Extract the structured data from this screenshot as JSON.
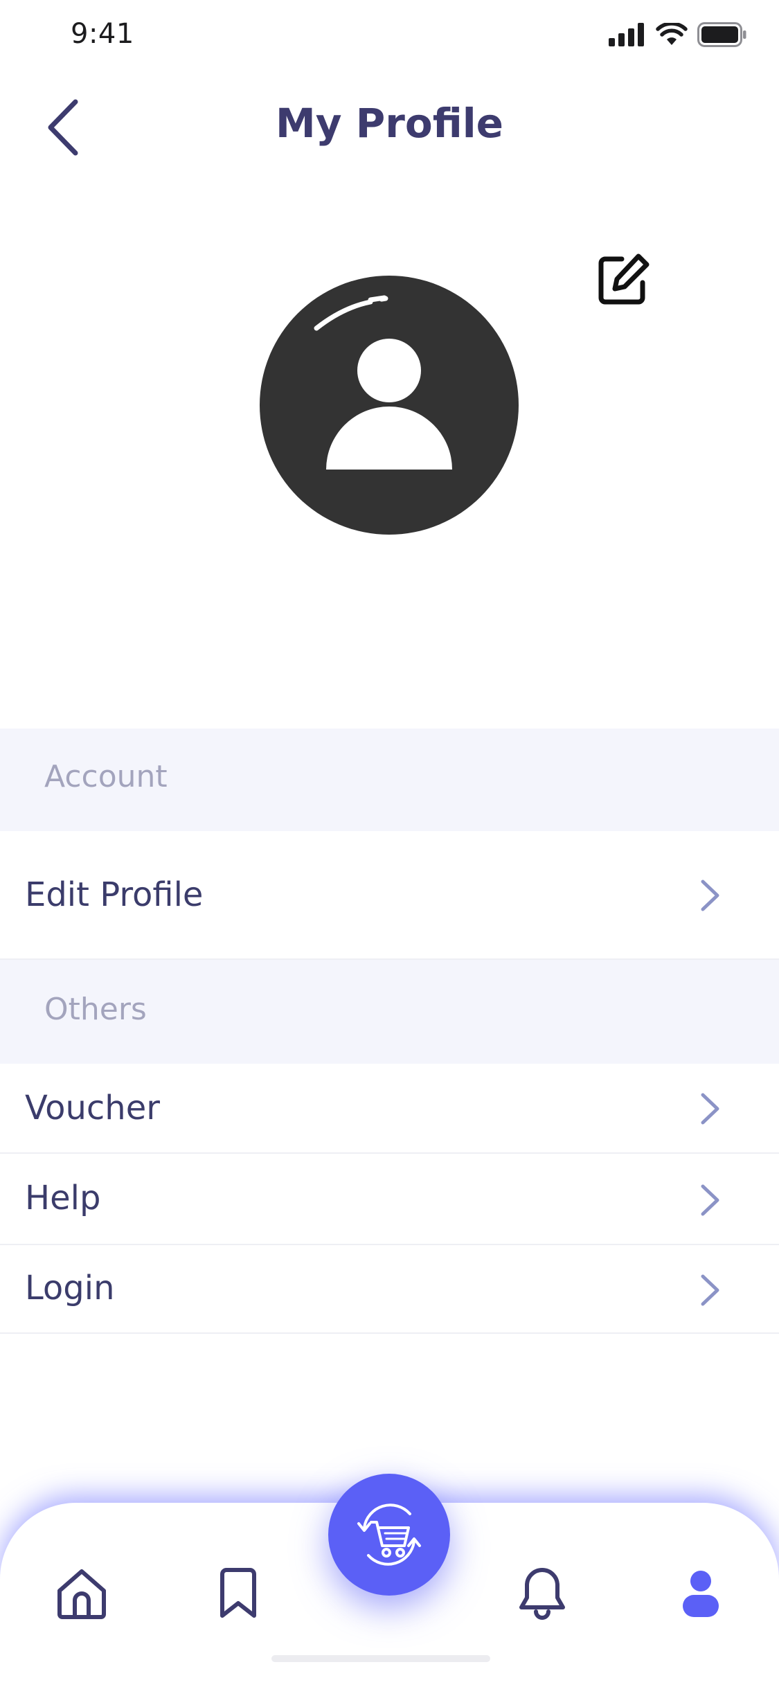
{
  "status_bar": {
    "time": "9:41"
  },
  "header": {
    "title": "My Profile",
    "back_icon": "chevron-left-icon"
  },
  "profile": {
    "avatar_icon": "user-avatar-icon",
    "edit_icon": "edit-square-icon"
  },
  "sections": {
    "account": {
      "label": "Account",
      "items": [
        {
          "label": "Edit Profile"
        }
      ]
    },
    "others": {
      "label": "Others",
      "items": [
        {
          "label": "Voucher"
        },
        {
          "label": "Help"
        },
        {
          "label": "Login"
        }
      ]
    }
  },
  "bottom_nav": {
    "items": [
      {
        "icon": "home-icon"
      },
      {
        "icon": "bookmark-icon"
      },
      {
        "icon": "cart-swap-icon"
      },
      {
        "icon": "bell-icon"
      },
      {
        "icon": "profile-icon"
      }
    ],
    "active": "profile-icon"
  },
  "colors": {
    "accent": "#5b60f6",
    "title_text": "#3d3b6e",
    "section_bg": "#f4f5fc",
    "section_text": "#a3a4bd",
    "chevron": "#8b93c6",
    "avatar_bg": "#333333"
  }
}
